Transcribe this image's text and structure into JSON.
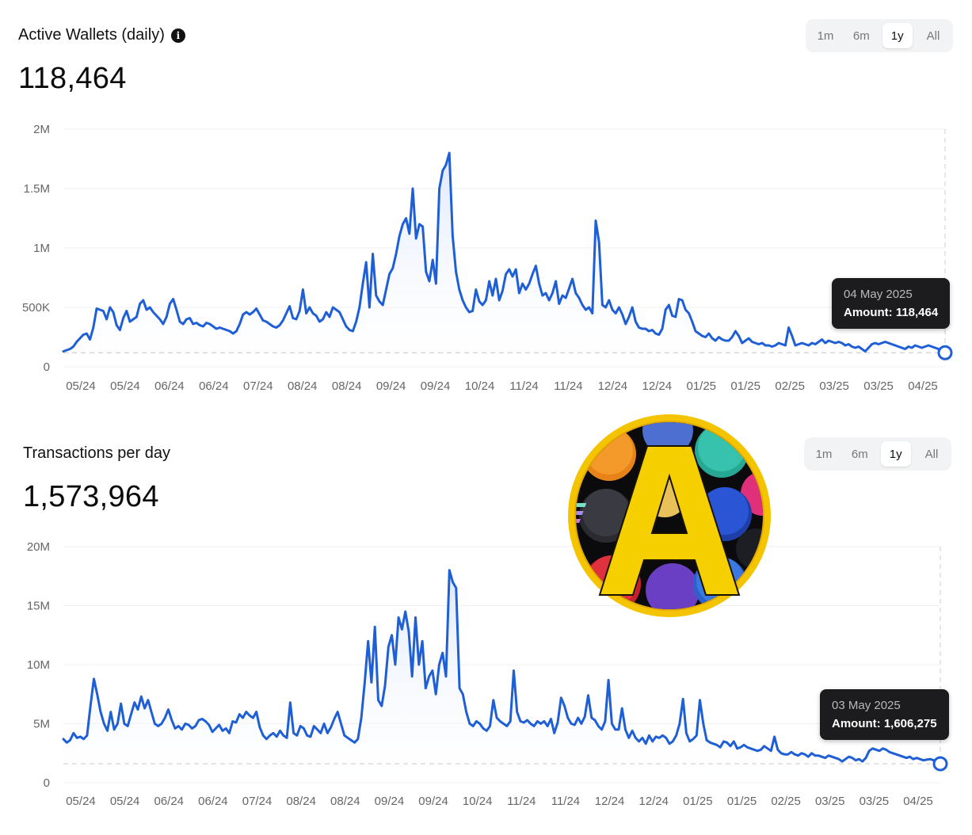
{
  "charts": [
    {
      "id": "wallets",
      "title": "Active Wallets (daily)",
      "has_info_icon": true,
      "value": "118,464",
      "range_options": [
        "1m",
        "6m",
        "1y",
        "All"
      ],
      "range_selected": "1y",
      "tooltip": {
        "date": "04 May 2025",
        "amount": "Amount: 118,464"
      }
    },
    {
      "id": "tx",
      "title": "Transactions per day",
      "has_info_icon": false,
      "value": "1,573,964",
      "range_options": [
        "1m",
        "6m",
        "1y",
        "All"
      ],
      "range_selected": "1y",
      "tooltip": {
        "date": "03 May 2025",
        "amount": "Amount: 1,606,275"
      }
    }
  ],
  "chart_data": [
    {
      "type": "area",
      "x_tick_labels": [
        "05/24",
        "05/24",
        "06/24",
        "06/24",
        "07/24",
        "08/24",
        "08/24",
        "09/24",
        "09/24",
        "10/24",
        "11/24",
        "11/24",
        "12/24",
        "12/24",
        "01/25",
        "01/25",
        "02/25",
        "03/25",
        "03/25",
        "04/25"
      ],
      "y_tick_labels": [
        "0",
        "500K",
        "1M",
        "1.5M",
        "2M"
      ],
      "ylim": [
        0,
        2000000
      ],
      "line_color": "#1f5fd6",
      "fill_color": "#dfe8fb",
      "highlight": {
        "x": 1.0,
        "y": 118464
      },
      "values": [
        130000,
        140000,
        150000,
        170000,
        210000,
        240000,
        270000,
        280000,
        230000,
        330000,
        490000,
        480000,
        470000,
        400000,
        500000,
        460000,
        350000,
        310000,
        410000,
        470000,
        380000,
        400000,
        420000,
        530000,
        560000,
        480000,
        500000,
        460000,
        430000,
        400000,
        360000,
        420000,
        530000,
        570000,
        480000,
        380000,
        360000,
        400000,
        410000,
        360000,
        370000,
        350000,
        340000,
        370000,
        360000,
        340000,
        320000,
        330000,
        320000,
        310000,
        300000,
        280000,
        300000,
        360000,
        440000,
        460000,
        440000,
        460000,
        490000,
        440000,
        390000,
        380000,
        360000,
        340000,
        330000,
        350000,
        390000,
        450000,
        510000,
        410000,
        400000,
        470000,
        650000,
        450000,
        500000,
        450000,
        430000,
        380000,
        400000,
        460000,
        420000,
        500000,
        480000,
        460000,
        400000,
        340000,
        310000,
        300000,
        380000,
        500000,
        700000,
        880000,
        500000,
        950000,
        600000,
        550000,
        520000,
        650000,
        780000,
        830000,
        950000,
        1100000,
        1200000,
        1250000,
        1120000,
        1500000,
        1080000,
        1200000,
        1180000,
        800000,
        720000,
        900000,
        700000,
        1500000,
        1650000,
        1700000,
        1800000,
        1100000,
        800000,
        650000,
        560000,
        500000,
        460000,
        470000,
        650000,
        550000,
        520000,
        560000,
        720000,
        600000,
        740000,
        560000,
        640000,
        780000,
        820000,
        760000,
        820000,
        620000,
        700000,
        650000,
        700000,
        780000,
        850000,
        700000,
        600000,
        620000,
        560000,
        620000,
        720000,
        530000,
        600000,
        580000,
        660000,
        740000,
        620000,
        580000,
        520000,
        480000,
        500000,
        450000,
        1230000,
        1050000,
        520000,
        500000,
        560000,
        480000,
        450000,
        500000,
        440000,
        360000,
        420000,
        500000,
        380000,
        330000,
        320000,
        320000,
        300000,
        310000,
        280000,
        270000,
        320000,
        480000,
        520000,
        430000,
        420000,
        570000,
        560000,
        480000,
        450000,
        380000,
        300000,
        280000,
        260000,
        250000,
        280000,
        240000,
        220000,
        250000,
        230000,
        220000,
        220000,
        250000,
        300000,
        260000,
        200000,
        220000,
        240000,
        210000,
        200000,
        190000,
        200000,
        180000,
        180000,
        170000,
        180000,
        200000,
        190000,
        180000,
        330000,
        260000,
        180000,
        190000,
        200000,
        190000,
        180000,
        200000,
        190000,
        210000,
        230000,
        200000,
        220000,
        210000,
        200000,
        210000,
        200000,
        180000,
        190000,
        170000,
        160000,
        170000,
        150000,
        130000,
        160000,
        190000,
        200000,
        190000,
        200000,
        210000,
        200000,
        190000,
        180000,
        170000,
        160000,
        150000,
        170000,
        160000,
        180000,
        170000,
        160000,
        170000,
        180000,
        170000,
        160000,
        150000,
        140000,
        118464
      ]
    },
    {
      "type": "area",
      "x_tick_labels": [
        "05/24",
        "05/24",
        "06/24",
        "06/24",
        "07/24",
        "08/24",
        "08/24",
        "09/24",
        "09/24",
        "10/24",
        "11/24",
        "11/24",
        "12/24",
        "12/24",
        "01/25",
        "01/25",
        "02/25",
        "03/25",
        "03/25",
        "04/25"
      ],
      "y_tick_labels": [
        "0",
        "5M",
        "10M",
        "15M",
        "20M"
      ],
      "ylim": [
        0,
        20000000
      ],
      "line_color": "#1f5fd6",
      "fill_color": "#dfe8fb",
      "highlight": {
        "x": 1.0,
        "y": 1606275
      },
      "values": [
        3700000,
        3400000,
        3600000,
        4200000,
        3800000,
        3900000,
        3700000,
        4000000,
        6500000,
        8800000,
        7500000,
        6000000,
        5000000,
        4400000,
        6000000,
        4500000,
        5000000,
        6700000,
        5000000,
        4800000,
        5800000,
        6800000,
        6200000,
        7300000,
        6300000,
        7000000,
        6000000,
        5000000,
        4800000,
        5000000,
        5500000,
        6200000,
        5300000,
        4600000,
        4800000,
        4500000,
        5000000,
        4900000,
        4600000,
        4800000,
        5300000,
        5400000,
        5200000,
        4900000,
        4300000,
        4600000,
        4900000,
        4400000,
        4600000,
        4200000,
        5200000,
        5100000,
        5800000,
        5500000,
        6000000,
        5700000,
        5500000,
        6000000,
        4700000,
        4000000,
        3700000,
        4000000,
        4200000,
        3900000,
        4400000,
        4000000,
        3800000,
        6800000,
        4200000,
        4000000,
        4800000,
        4600000,
        4000000,
        3900000,
        4800000,
        4500000,
        4200000,
        5000000,
        4200000,
        4700000,
        5400000,
        6000000,
        5000000,
        4000000,
        3800000,
        3600000,
        3400000,
        3700000,
        5500000,
        8500000,
        12000000,
        8500000,
        13200000,
        7000000,
        6500000,
        8200000,
        11500000,
        12500000,
        10000000,
        14000000,
        13000000,
        14500000,
        12800000,
        9000000,
        14000000,
        10000000,
        12000000,
        8000000,
        9000000,
        9500000,
        7500000,
        10000000,
        11000000,
        9000000,
        18000000,
        17000000,
        16500000,
        8000000,
        7500000,
        6000000,
        5000000,
        4800000,
        5200000,
        5000000,
        4600000,
        4400000,
        4800000,
        7000000,
        5500000,
        5200000,
        5000000,
        4800000,
        5200000,
        9500000,
        6000000,
        5200000,
        5100000,
        5300000,
        5000000,
        4800000,
        5200000,
        5000000,
        5200000,
        4800000,
        5400000,
        4200000,
        5100000,
        7200000,
        6500000,
        5500000,
        5000000,
        4900000,
        5500000,
        5000000,
        5600000,
        7400000,
        5500000,
        5300000,
        4800000,
        4500000,
        5200000,
        8700000,
        5000000,
        4500000,
        4500000,
        6300000,
        4500000,
        3800000,
        4400000,
        3800000,
        3500000,
        3800000,
        3300000,
        4000000,
        3500000,
        3900000,
        3800000,
        4000000,
        3800000,
        3300000,
        3500000,
        4000000,
        5000000,
        7100000,
        4200000,
        3500000,
        3700000,
        4000000,
        7000000,
        5000000,
        3600000,
        3400000,
        3300000,
        3200000,
        3000000,
        3500000,
        3400000,
        3100000,
        3500000,
        2900000,
        3000000,
        3200000,
        3000000,
        2900000,
        2800000,
        2700000,
        2800000,
        3100000,
        2900000,
        2700000,
        3900000,
        2800000,
        2500000,
        2400000,
        2400000,
        2600000,
        2400000,
        2300000,
        2500000,
        2400000,
        2200000,
        2500000,
        2300000,
        2300000,
        2200000,
        2100000,
        2300000,
        2200000,
        2100000,
        2000000,
        1800000,
        2000000,
        2200000,
        2100000,
        1900000,
        2000000,
        1800000,
        2100000,
        2700000,
        2900000,
        2800000,
        2700000,
        2900000,
        2800000,
        2600000,
        2500000,
        2400000,
        2300000,
        2200000,
        2100000,
        2200000,
        2000000,
        2100000,
        2000000,
        1900000,
        1950000,
        2000000,
        1900000,
        1800000,
        1606275
      ]
    }
  ]
}
